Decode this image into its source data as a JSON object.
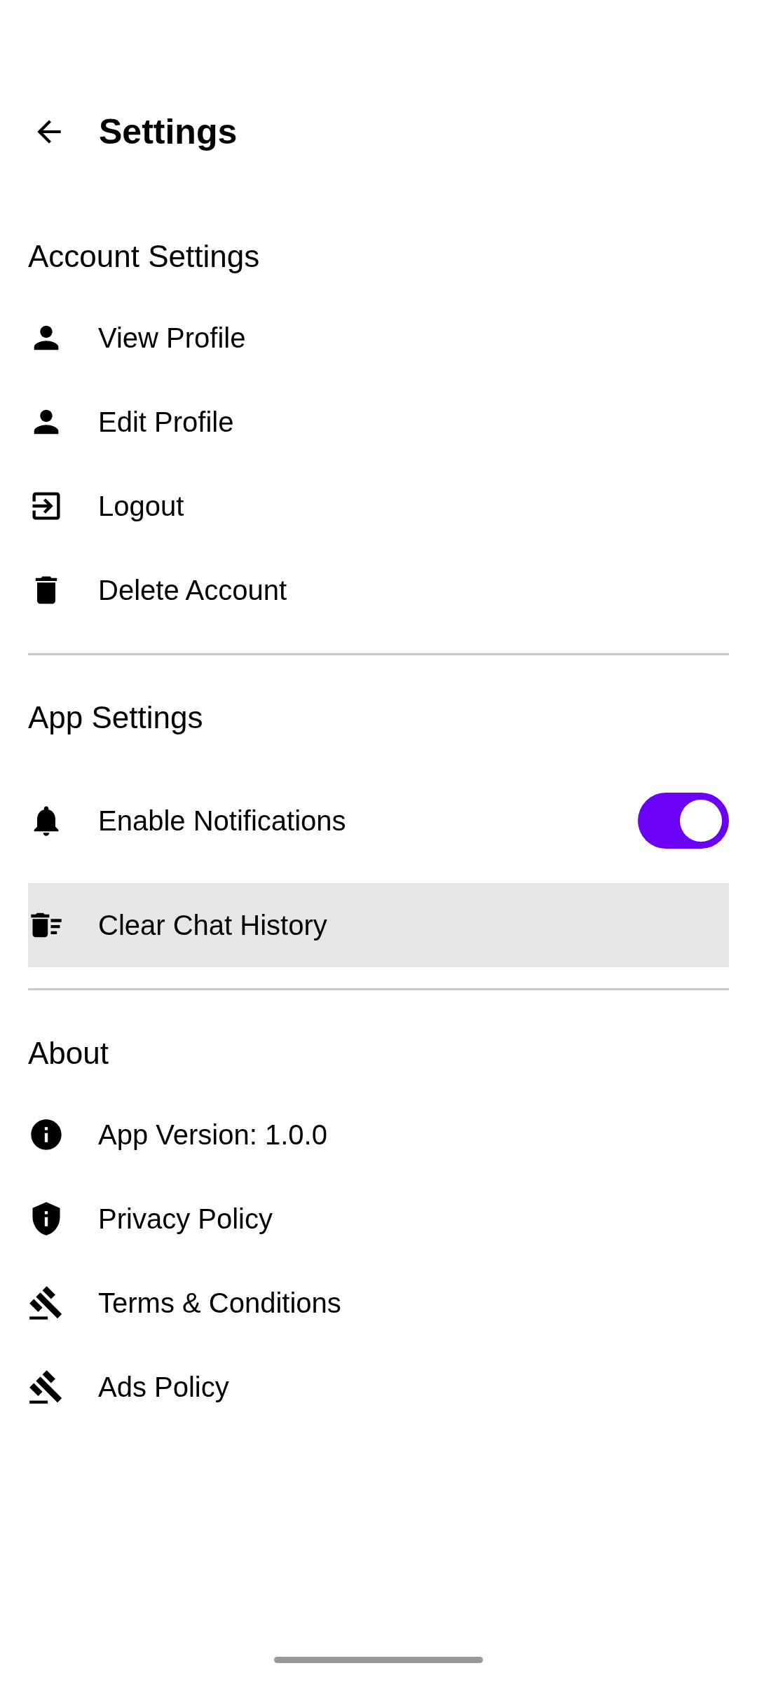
{
  "header": {
    "title": "Settings"
  },
  "sections": [
    {
      "title": "Account Settings",
      "items": [
        {
          "kind": "link",
          "label": "View Profile"
        },
        {
          "kind": "link",
          "label": "Edit Profile"
        },
        {
          "kind": "link",
          "label": "Logout"
        },
        {
          "kind": "link",
          "label": "Delete Account"
        }
      ]
    },
    {
      "title": "App Settings",
      "items": [
        {
          "kind": "toggle",
          "label": "Enable Notifications",
          "on": true
        },
        {
          "kind": "link",
          "label": "Clear Chat History",
          "highlighted": true
        }
      ]
    },
    {
      "title": "About",
      "items": [
        {
          "kind": "link",
          "label": "App Version: 1.0.0"
        },
        {
          "kind": "link",
          "label": "Privacy Policy"
        },
        {
          "kind": "link",
          "label": "Terms & Conditions"
        },
        {
          "kind": "link",
          "label": "Ads Policy"
        }
      ]
    }
  ]
}
